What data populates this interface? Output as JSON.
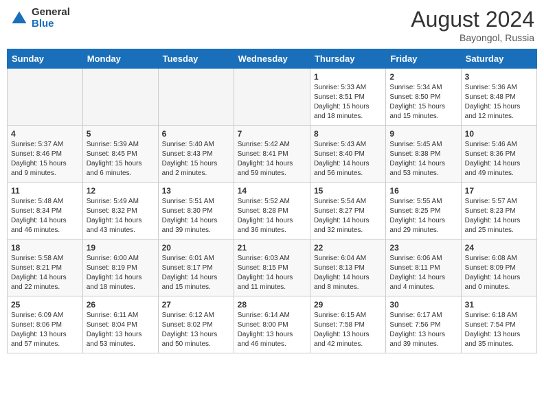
{
  "header": {
    "logo_general": "General",
    "logo_blue": "Blue",
    "month_year": "August 2024",
    "location": "Bayongol, Russia"
  },
  "days_of_week": [
    "Sunday",
    "Monday",
    "Tuesday",
    "Wednesday",
    "Thursday",
    "Friday",
    "Saturday"
  ],
  "weeks": [
    [
      {
        "day": "",
        "info": "",
        "empty": true
      },
      {
        "day": "",
        "info": "",
        "empty": true
      },
      {
        "day": "",
        "info": "",
        "empty": true
      },
      {
        "day": "",
        "info": "",
        "empty": true
      },
      {
        "day": "1",
        "info": "Sunrise: 5:33 AM\nSunset: 8:51 PM\nDaylight: 15 hours\nand 18 minutes.",
        "empty": false
      },
      {
        "day": "2",
        "info": "Sunrise: 5:34 AM\nSunset: 8:50 PM\nDaylight: 15 hours\nand 15 minutes.",
        "empty": false
      },
      {
        "day": "3",
        "info": "Sunrise: 5:36 AM\nSunset: 8:48 PM\nDaylight: 15 hours\nand 12 minutes.",
        "empty": false
      }
    ],
    [
      {
        "day": "4",
        "info": "Sunrise: 5:37 AM\nSunset: 8:46 PM\nDaylight: 15 hours\nand 9 minutes.",
        "empty": false
      },
      {
        "day": "5",
        "info": "Sunrise: 5:39 AM\nSunset: 8:45 PM\nDaylight: 15 hours\nand 6 minutes.",
        "empty": false
      },
      {
        "day": "6",
        "info": "Sunrise: 5:40 AM\nSunset: 8:43 PM\nDaylight: 15 hours\nand 2 minutes.",
        "empty": false
      },
      {
        "day": "7",
        "info": "Sunrise: 5:42 AM\nSunset: 8:41 PM\nDaylight: 14 hours\nand 59 minutes.",
        "empty": false
      },
      {
        "day": "8",
        "info": "Sunrise: 5:43 AM\nSunset: 8:40 PM\nDaylight: 14 hours\nand 56 minutes.",
        "empty": false
      },
      {
        "day": "9",
        "info": "Sunrise: 5:45 AM\nSunset: 8:38 PM\nDaylight: 14 hours\nand 53 minutes.",
        "empty": false
      },
      {
        "day": "10",
        "info": "Sunrise: 5:46 AM\nSunset: 8:36 PM\nDaylight: 14 hours\nand 49 minutes.",
        "empty": false
      }
    ],
    [
      {
        "day": "11",
        "info": "Sunrise: 5:48 AM\nSunset: 8:34 PM\nDaylight: 14 hours\nand 46 minutes.",
        "empty": false
      },
      {
        "day": "12",
        "info": "Sunrise: 5:49 AM\nSunset: 8:32 PM\nDaylight: 14 hours\nand 43 minutes.",
        "empty": false
      },
      {
        "day": "13",
        "info": "Sunrise: 5:51 AM\nSunset: 8:30 PM\nDaylight: 14 hours\nand 39 minutes.",
        "empty": false
      },
      {
        "day": "14",
        "info": "Sunrise: 5:52 AM\nSunset: 8:28 PM\nDaylight: 14 hours\nand 36 minutes.",
        "empty": false
      },
      {
        "day": "15",
        "info": "Sunrise: 5:54 AM\nSunset: 8:27 PM\nDaylight: 14 hours\nand 32 minutes.",
        "empty": false
      },
      {
        "day": "16",
        "info": "Sunrise: 5:55 AM\nSunset: 8:25 PM\nDaylight: 14 hours\nand 29 minutes.",
        "empty": false
      },
      {
        "day": "17",
        "info": "Sunrise: 5:57 AM\nSunset: 8:23 PM\nDaylight: 14 hours\nand 25 minutes.",
        "empty": false
      }
    ],
    [
      {
        "day": "18",
        "info": "Sunrise: 5:58 AM\nSunset: 8:21 PM\nDaylight: 14 hours\nand 22 minutes.",
        "empty": false
      },
      {
        "day": "19",
        "info": "Sunrise: 6:00 AM\nSunset: 8:19 PM\nDaylight: 14 hours\nand 18 minutes.",
        "empty": false
      },
      {
        "day": "20",
        "info": "Sunrise: 6:01 AM\nSunset: 8:17 PM\nDaylight: 14 hours\nand 15 minutes.",
        "empty": false
      },
      {
        "day": "21",
        "info": "Sunrise: 6:03 AM\nSunset: 8:15 PM\nDaylight: 14 hours\nand 11 minutes.",
        "empty": false
      },
      {
        "day": "22",
        "info": "Sunrise: 6:04 AM\nSunset: 8:13 PM\nDaylight: 14 hours\nand 8 minutes.",
        "empty": false
      },
      {
        "day": "23",
        "info": "Sunrise: 6:06 AM\nSunset: 8:11 PM\nDaylight: 14 hours\nand 4 minutes.",
        "empty": false
      },
      {
        "day": "24",
        "info": "Sunrise: 6:08 AM\nSunset: 8:09 PM\nDaylight: 14 hours\nand 0 minutes.",
        "empty": false
      }
    ],
    [
      {
        "day": "25",
        "info": "Sunrise: 6:09 AM\nSunset: 8:06 PM\nDaylight: 13 hours\nand 57 minutes.",
        "empty": false
      },
      {
        "day": "26",
        "info": "Sunrise: 6:11 AM\nSunset: 8:04 PM\nDaylight: 13 hours\nand 53 minutes.",
        "empty": false
      },
      {
        "day": "27",
        "info": "Sunrise: 6:12 AM\nSunset: 8:02 PM\nDaylight: 13 hours\nand 50 minutes.",
        "empty": false
      },
      {
        "day": "28",
        "info": "Sunrise: 6:14 AM\nSunset: 8:00 PM\nDaylight: 13 hours\nand 46 minutes.",
        "empty": false
      },
      {
        "day": "29",
        "info": "Sunrise: 6:15 AM\nSunset: 7:58 PM\nDaylight: 13 hours\nand 42 minutes.",
        "empty": false
      },
      {
        "day": "30",
        "info": "Sunrise: 6:17 AM\nSunset: 7:56 PM\nDaylight: 13 hours\nand 39 minutes.",
        "empty": false
      },
      {
        "day": "31",
        "info": "Sunrise: 6:18 AM\nSunset: 7:54 PM\nDaylight: 13 hours\nand 35 minutes.",
        "empty": false
      }
    ]
  ]
}
